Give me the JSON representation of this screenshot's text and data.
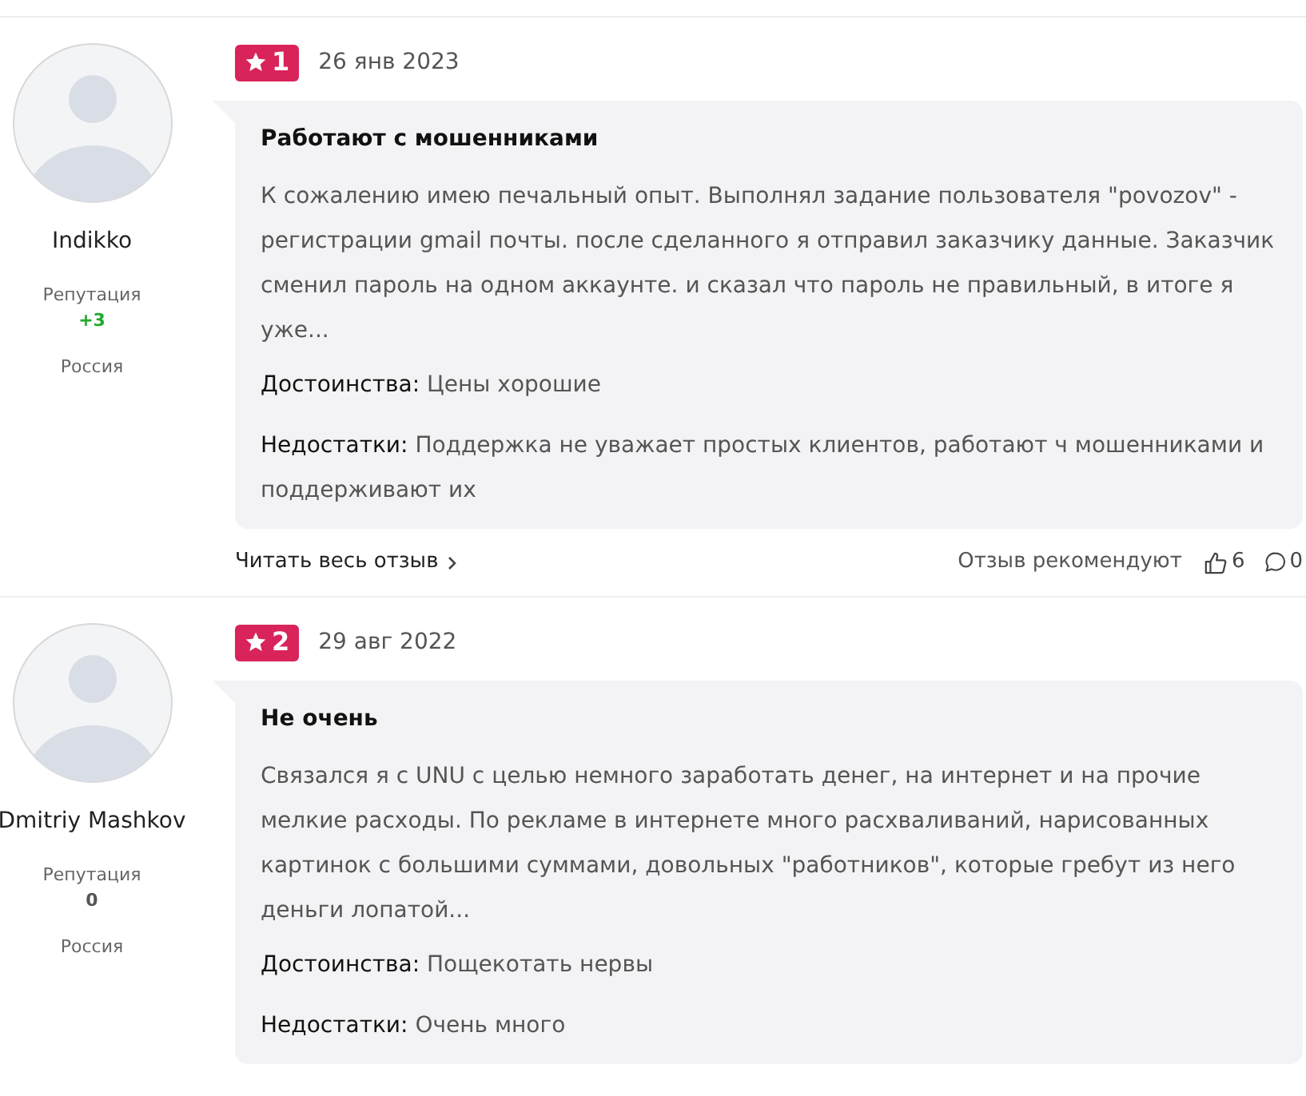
{
  "reviews": [
    {
      "author": {
        "name": "Indikko",
        "reputation_label": "Репутация",
        "reputation": {
          "value": "+3",
          "color": "#1faa2e"
        },
        "country": "Россия"
      },
      "rating": "1",
      "date": "26 янв 2023",
      "title": "Работают с мошенниками",
      "text": "К сожалению имею печальный опыт. Выполнял задание пользователя \"povozov\" - регистрации gmail почты. после сделанного я отправил заказчику данные. Заказчик сменил пароль на одном аккаунте. и сказал что пароль не правильный, в итоге я уже...",
      "pros_label": "Достоинства:",
      "pros": "Цены хорошие",
      "cons_label": "Недостатки:",
      "cons": "Поддержка не уважает простых клиентов, работают ч мошенниками и поддерживают их",
      "footer": {
        "read_more": "Читать весь отзыв",
        "recommend_label": "Отзыв рекомендуют",
        "likes": "6",
        "comments": "0"
      }
    },
    {
      "author": {
        "name": "Dmitriy Mashkov",
        "reputation_label": "Репутация",
        "reputation": {
          "value": "0",
          "color": "#555555"
        },
        "country": "Россия"
      },
      "rating": "2",
      "date": "29 авг 2022",
      "title": "Не очень",
      "text": "Связался я с UNU с целью немного заработать денег, на интернет и на прочие мелкие расходы. По рекламе в интернете много расхваливаний, нарисованных картинок с большими суммами, довольных \"работников\", которые гребут из него деньги лопатой...",
      "pros_label": "Достоинства:",
      "pros": "Пощекотать нервы",
      "cons_label": "Недостатки:",
      "cons": "Очень много"
    }
  ]
}
